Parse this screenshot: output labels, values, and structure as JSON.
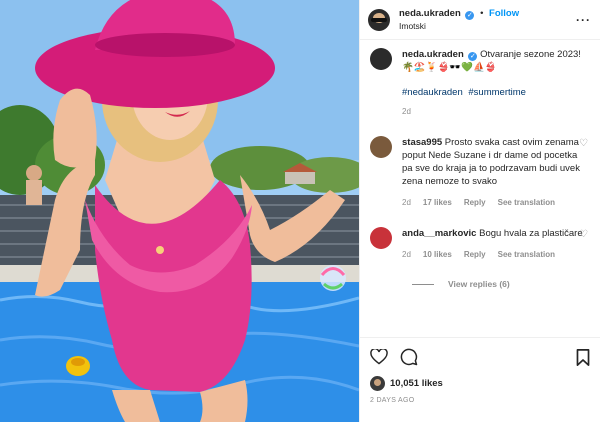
{
  "post": {
    "username": "neda.ukraden",
    "follow_label": "Follow",
    "location": "Imotski",
    "caption_user": "neda.ukraden",
    "caption_text": "Otvaranje sezone 2023! 🌴🏖️🍹👙🕶️💚⛵👙",
    "hashtags": [
      "#nedaukraden",
      "#summertime"
    ],
    "caption_time": "2d",
    "likes": "10,051 likes",
    "posted_ago": "2 DAYS AGO"
  },
  "comments": [
    {
      "user": "stasa995",
      "text": "Prosto svaka cast ovim zenama poput Nede Suzane i dr dame od pocetka pa sve do kraja ja to podrzavam budi uvek zena nemoze to svako",
      "time": "2d",
      "likes": "17 likes",
      "reply": "Reply",
      "translation": "See translation"
    },
    {
      "user": "anda__markovic",
      "text": "Bogu hvala za plastičare",
      "time": "2d",
      "likes": "10 likes",
      "reply": "Reply",
      "translation": "See translation"
    }
  ],
  "view_replies": "View replies (6)",
  "icons": {
    "verified": "verified-badge",
    "more": "more-options-icon",
    "like": "heart-icon",
    "comment": "comment-icon",
    "save": "bookmark-icon"
  },
  "colors": {
    "accent": "#0095f6",
    "verified": "#3897f0",
    "hashtag": "#00376b",
    "muted": "#8e8e8e",
    "swimsuit": "#e2378e",
    "hat": "#d41c78",
    "pool": "#2e8fe8"
  }
}
